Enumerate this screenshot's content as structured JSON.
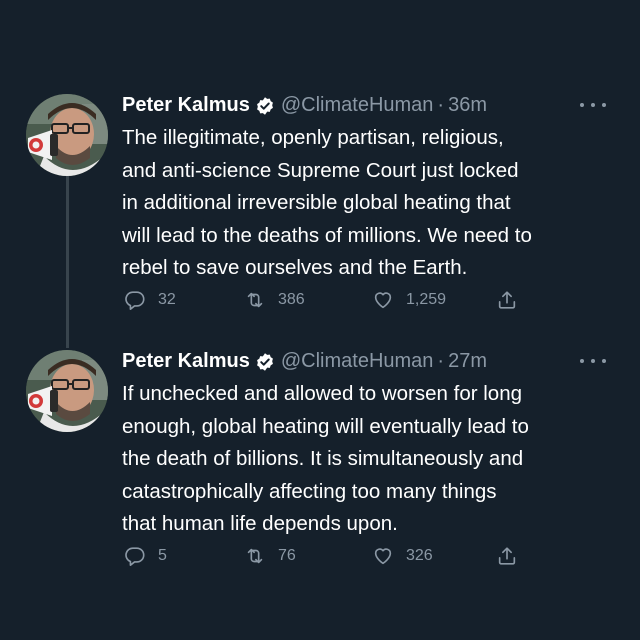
{
  "tweets": [
    {
      "name": "Peter Kalmus",
      "handle": "@ClimateHuman",
      "separator": "·",
      "time": "36m",
      "lines": [
        "The illegitimate, openly partisan, religious,",
        "and anti-science Supreme Court just locked",
        "in additional irreversible global heating that",
        "will lead to the deaths of millions. We need to",
        "rebel to save ourselves and the Earth."
      ],
      "replies": "32",
      "retweets": "386",
      "likes": "1,259"
    },
    {
      "name": "Peter Kalmus",
      "handle": "@ClimateHuman",
      "separator": "·",
      "time": "27m",
      "lines": [
        "If unchecked and allowed to worsen for long",
        "enough, global heating will eventually lead to",
        "the death of billions. It is simultaneously and",
        "catastrophically affecting too many things",
        "that human life depends upon."
      ],
      "replies": "5",
      "retweets": "76",
      "likes": "326"
    }
  ],
  "colors": {
    "background": "#15202b",
    "text": "#ffffff",
    "secondary": "#8b98a5",
    "thread_line": "#38444d",
    "verified": "#ffffff"
  },
  "icons": {
    "verified": "verified-badge-icon",
    "more": "more-options-icon",
    "reply": "reply-icon",
    "retweet": "retweet-icon",
    "like": "heart-icon",
    "share": "share-icon"
  }
}
